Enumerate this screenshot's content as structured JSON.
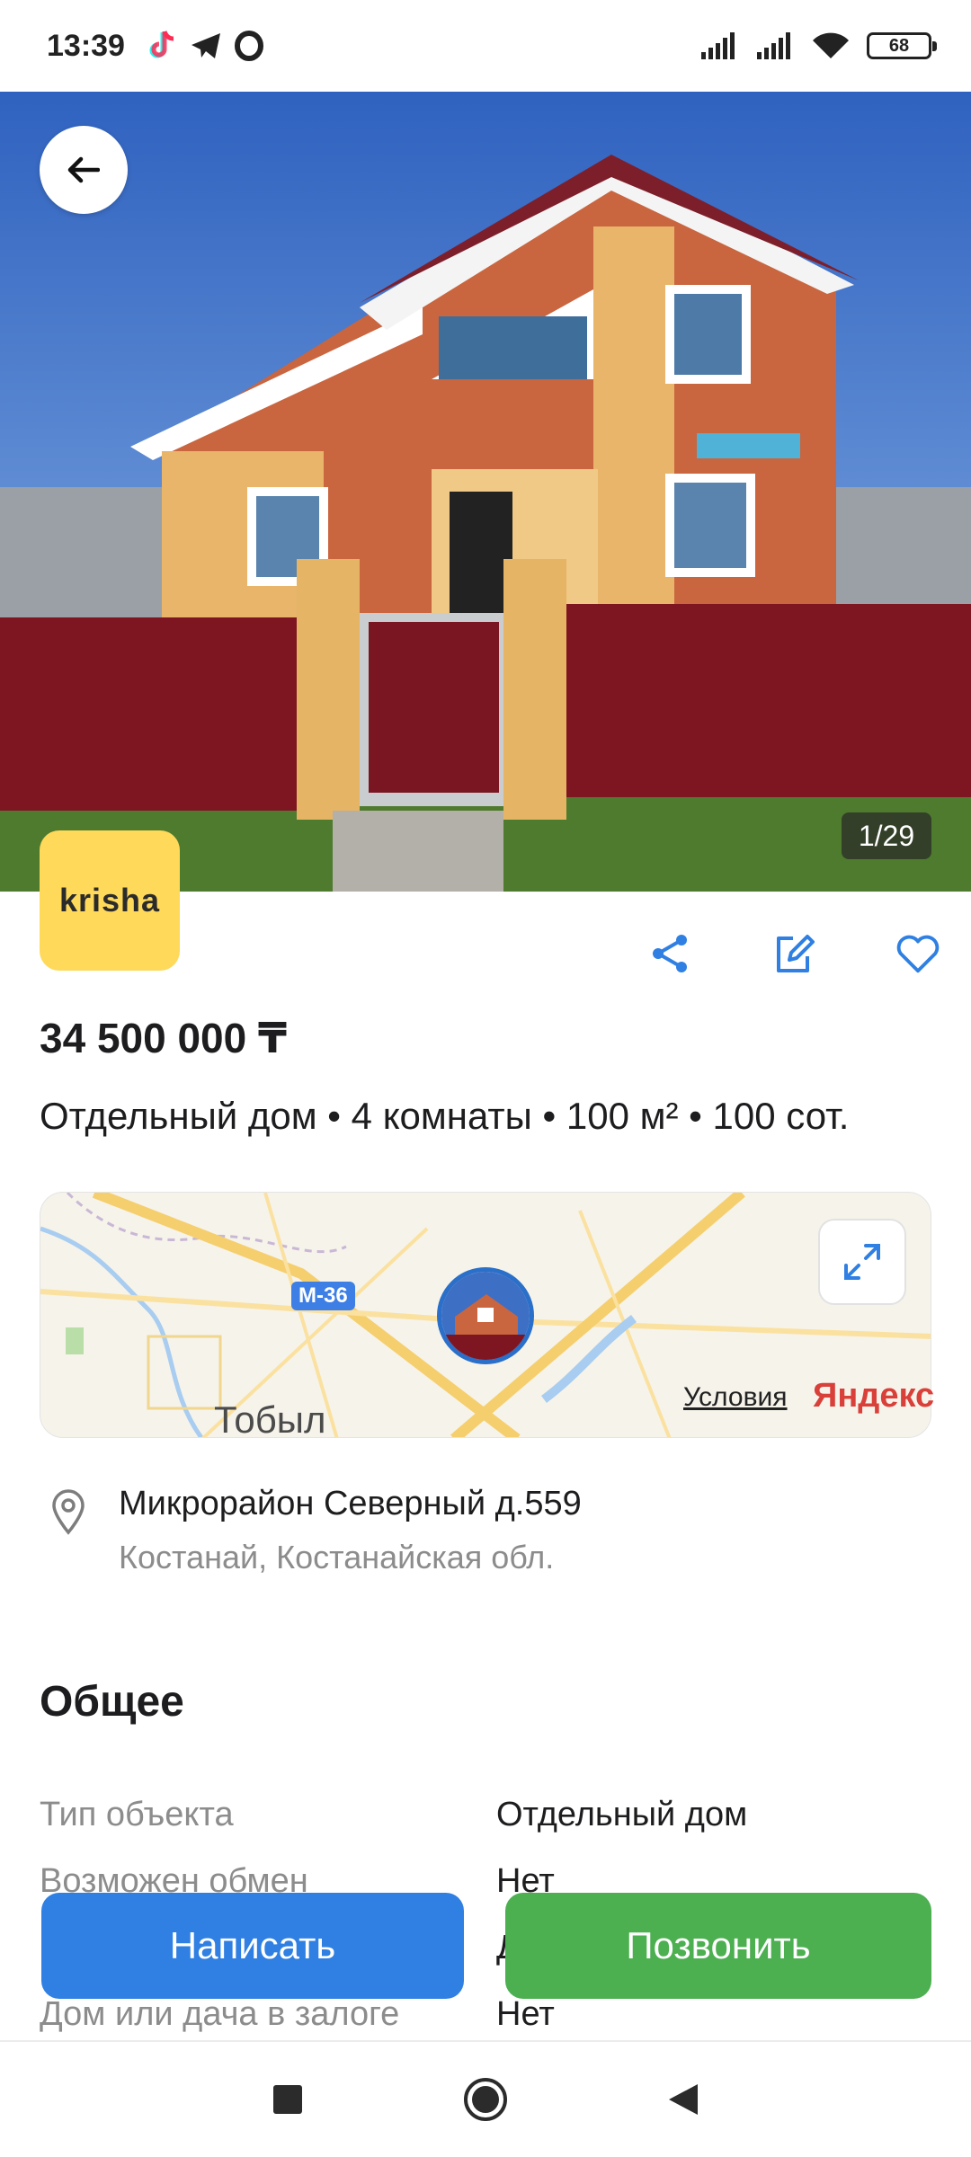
{
  "status_bar": {
    "time": "13:39",
    "battery": "68",
    "icons": [
      "tiktok-icon",
      "telegram-icon",
      "opera-icon",
      "signal-icon",
      "signal-icon",
      "wifi-icon",
      "battery-icon"
    ]
  },
  "gallery": {
    "counter": "1/29"
  },
  "logo": {
    "text": "krisha"
  },
  "listing": {
    "price": "34 500 000 ₸",
    "subtitle": "Отдельный дом • 4 комнаты • 100 м² • 100 сот."
  },
  "map": {
    "road_label": "М-36",
    "city_label": "Тобыл",
    "terms_link": "Условия",
    "brand": "Яндекс"
  },
  "address": {
    "line1": "Микрорайон Северный д.559",
    "line2": "Костанай, Костанайская обл."
  },
  "general": {
    "title": "Общее",
    "rows": [
      {
        "label": "Тип объекта",
        "value": "Отдельный дом"
      },
      {
        "label": "Возможен обмен",
        "value": "Нет"
      },
      {
        "label": "",
        "value": "Д"
      },
      {
        "label": "Дом или дача в залоге",
        "value": "Нет"
      }
    ]
  },
  "buttons": {
    "write": "Написать",
    "call": "Позвонить"
  },
  "colors": {
    "accent_blue": "#2f80e2",
    "call_green": "#4caf50",
    "logo_yellow": "#ffd95a"
  }
}
